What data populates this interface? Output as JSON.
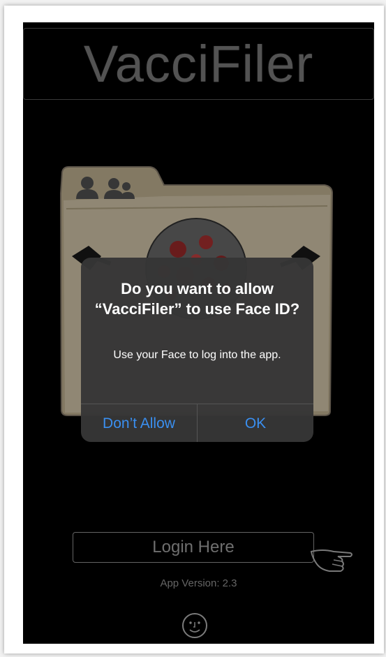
{
  "app": {
    "title": "VacciFiler"
  },
  "login": {
    "label": "Login Here"
  },
  "version": {
    "text": "App Version: 2.3"
  },
  "alert": {
    "title": "Do you want to allow “VacciFiler” to use Face ID?",
    "message": "Use your Face to log into the app.",
    "deny_label": "Don’t Allow",
    "ok_label": "OK"
  },
  "colors": {
    "background": "#000000",
    "folder": "#d9ccae",
    "alert_bg": "#363636",
    "alert_button": "#3a8ff0",
    "title_text": "#808080"
  },
  "icons": [
    "person-icon",
    "people-icon",
    "coronavirus-image",
    "pushpin-icon",
    "pointing-hand-icon",
    "face-id-icon"
  ]
}
